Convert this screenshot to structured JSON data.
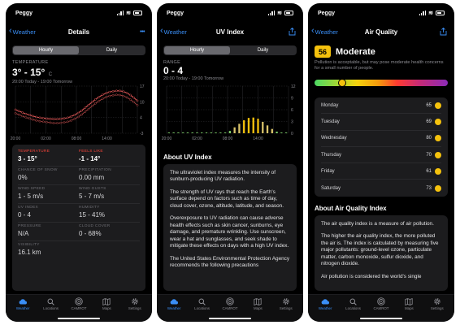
{
  "status": {
    "carrier": "Peggy"
  },
  "tabs": [
    {
      "label": "Weather",
      "icon": "weather-cloud-icon"
    },
    {
      "label": "Locations",
      "icon": "magnifier-icon"
    },
    {
      "label": "CAMROT",
      "icon": "radar-target-icon"
    },
    {
      "label": "Maps",
      "icon": "map-icon"
    },
    {
      "label": "Settings",
      "icon": "gear-icon"
    }
  ],
  "screen1": {
    "back_label": "Weather",
    "title": "Details",
    "more_label": "•••",
    "segments": [
      "Hourly",
      "Daily"
    ],
    "active_segment": 0,
    "metric_label": "TEMPERATURE",
    "metric_value": "3° - 15°",
    "metric_unit": "C",
    "range_text": "20:00 Today - 19:00 Tomorrow",
    "chart_data": {
      "type": "line",
      "series": [
        {
          "values": [
            7,
            6.4,
            5.8,
            5.2,
            4.8,
            4.3,
            3.9,
            3.6,
            3.4,
            3.2,
            3.1,
            3,
            3,
            3.1,
            3.3,
            3.6,
            4.1,
            4.8,
            5.6,
            6.6,
            7.8,
            9,
            10.2,
            11.4,
            12.4,
            13.3,
            14,
            14.5,
            14.8,
            15,
            15,
            14.7,
            14.1,
            13.2,
            12.1,
            10.8
          ]
        },
        {
          "values": [
            5.5,
            4.9,
            4.3,
            3.7,
            3.3,
            2.8,
            2.4,
            2.1,
            1.9,
            1.7,
            1.5,
            1.3,
            1.3,
            1.4,
            1.6,
            1.9,
            2.4,
            3.1,
            3.9,
            4.9,
            6.1,
            7.3,
            8.5,
            9.7,
            10.7,
            11.6,
            12.3,
            12.8,
            13.1,
            13.3,
            13.2,
            12.8,
            12.2,
            11.3,
            10.2,
            8.9
          ]
        }
      ],
      "x_ticks": [
        "20:00",
        "02:00",
        "08:00",
        "14:00"
      ],
      "y_ticks": [
        "17",
        "10",
        "4",
        "-3"
      ],
      "ylim": [
        -3,
        17
      ]
    },
    "details": [
      {
        "label": "TEMPERATURE",
        "value": "3 - 15°",
        "highlight": true
      },
      {
        "label": "FEELS LIKE",
        "value": "-1 - 14°",
        "highlight": true
      },
      {
        "label": "CHANCE OF SNOW",
        "value": "0%"
      },
      {
        "label": "PRECIPITATION",
        "value": "0.00 mm"
      },
      {
        "label": "WIND SPEED",
        "value": "1 - 5 m/s"
      },
      {
        "label": "WIND GUSTS",
        "value": "5 - 7 m/s"
      },
      {
        "label": "UV INDEX",
        "value": "0 - 4"
      },
      {
        "label": "HUMIDITY",
        "value": "15 - 41%"
      },
      {
        "label": "PRESSURE",
        "value": "N/A"
      },
      {
        "label": "CLOUD COVER",
        "value": "0 - 68%"
      },
      {
        "label": "VISIBILITY",
        "value": "16.1 km"
      }
    ]
  },
  "screen2": {
    "back_label": "Weather",
    "title": "UV Index",
    "segments": [
      "Hourly",
      "Daily"
    ],
    "active_segment": 0,
    "metric_label": "RANGE",
    "metric_value": "0 - 4",
    "range_text": "20:00 Today - 19:00 Tomorrow",
    "chart_data": {
      "type": "bar",
      "values": [
        0,
        0,
        0,
        0,
        0,
        0,
        0,
        0,
        0,
        0,
        0,
        0,
        0.1,
        0.6,
        1.5,
        2.4,
        3.3,
        3.9,
        4,
        3.7,
        2.9,
        2,
        1.1,
        0.4,
        0.1,
        0
      ],
      "x_ticks": [
        "20:00",
        "02:00",
        "08:00",
        "14:00"
      ],
      "y_ticks": [
        "12",
        "9",
        "6",
        "3",
        "0"
      ],
      "ylim": [
        0,
        12
      ]
    },
    "about_heading": "About UV Index",
    "about_paragraphs": [
      "The ultraviolet index measures the intensity of sunburn-producing UV radiation.",
      "The strength of UV rays that reach the Earth's surface depend on factors such as time of day, cloud cover, ozone, altitude, latitude, and season.",
      "Overexposure to UV radiation can cause adverse health effects such as skin cancer, sunburns, eye damage, and premature wrinkling. Use sunscreen, wear a hat and sunglasses, and seek shade to mitigate these effects on days with a high UV index.",
      "The United States Environmental Protection Agency recommends the following precautions"
    ]
  },
  "screen3": {
    "back_label": "Weather",
    "title": "Air Quality",
    "aqi_value": "56",
    "aqi_level": 56,
    "aqi_category": "Moderate",
    "aqi_description": "Pollution is acceptable, but may pose moderate health concerns for a small number of people.",
    "forecast": [
      {
        "day": "Monday",
        "value": "65"
      },
      {
        "day": "Tuesday",
        "value": "69"
      },
      {
        "day": "Wednesday",
        "value": "80"
      },
      {
        "day": "Thursday",
        "value": "70"
      },
      {
        "day": "Friday",
        "value": "61"
      },
      {
        "day": "Saturday",
        "value": "73"
      }
    ],
    "about_heading": "About Air Quality Index",
    "about_paragraphs": [
      "The air quality index is a measure of air pollution.",
      "The higher the air quality index, the more polluted the air is. The index is calculated by measuring five major pollutants: ground-level ozone, particulate matter, carbon monoxide, sulfur dioxide, and nitrogen dioxide.",
      "Air pollution is considered the world's single"
    ]
  },
  "colors": {
    "accent": "#3a8ef6",
    "aqi_moderate": "#f5c20d",
    "feels_like": "#ff453a",
    "temp_line": "#e05757"
  }
}
